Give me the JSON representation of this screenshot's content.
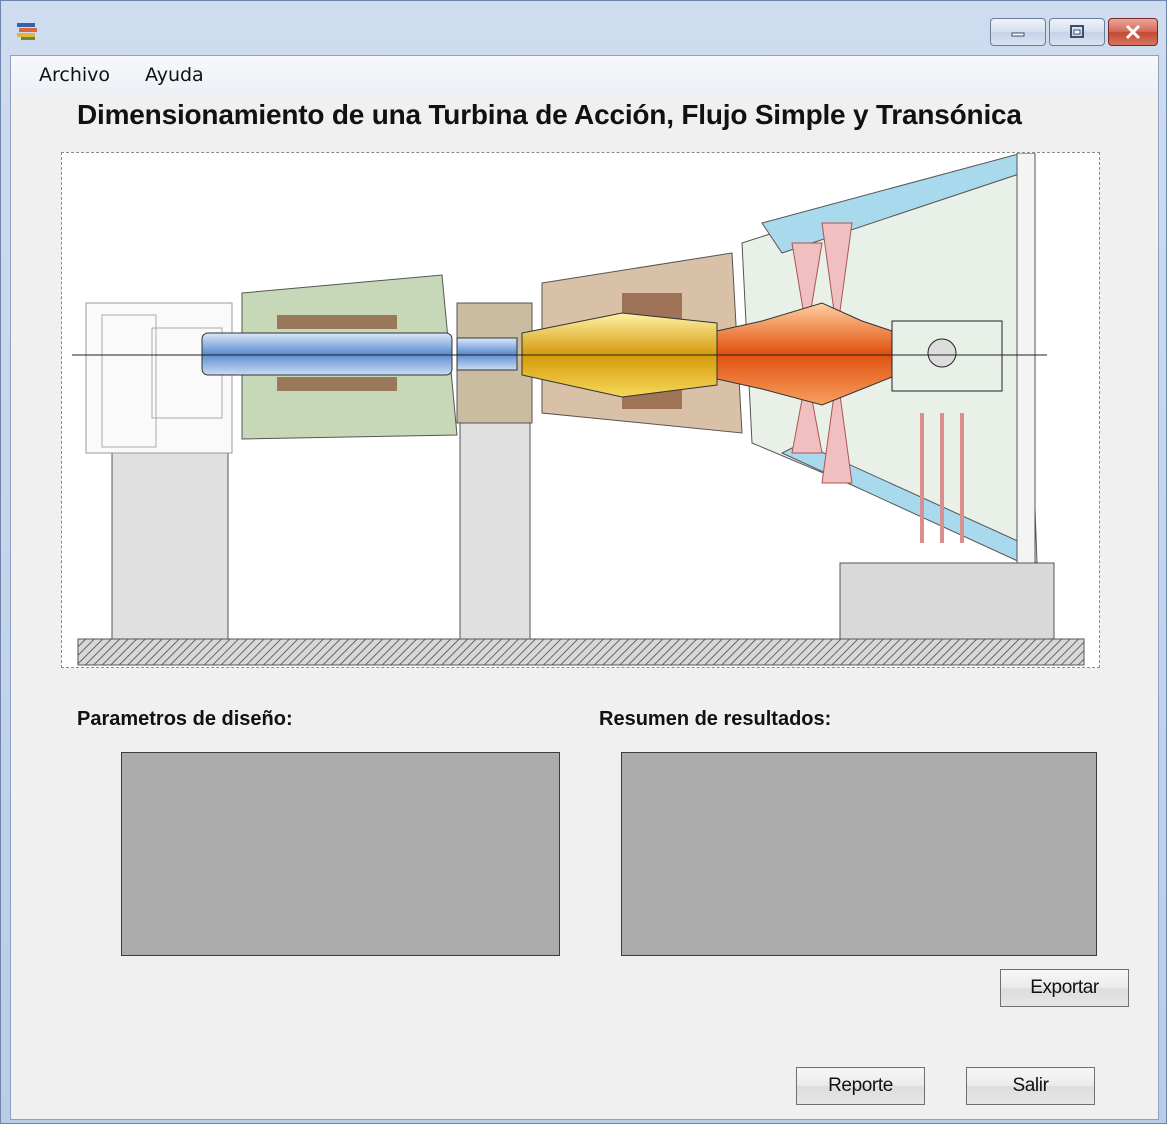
{
  "menu": {
    "items": [
      "Archivo",
      "Ayuda"
    ]
  },
  "heading": "Dimensionamiento de una Turbina de Acción, Flujo Simple y Transónica",
  "image": {
    "subject": "turbine cross-section"
  },
  "sections": {
    "design_params_label": "Parametros de diseño:",
    "results_label": "Resumen de resultados:"
  },
  "buttons": {
    "export": "Exportar",
    "report": "Reporte",
    "exit": "Salir"
  },
  "colors": {
    "panel": "#ababab",
    "client": "#f0f0f0",
    "title_gradient": "#c7d6ec",
    "close": "#c24a36"
  }
}
